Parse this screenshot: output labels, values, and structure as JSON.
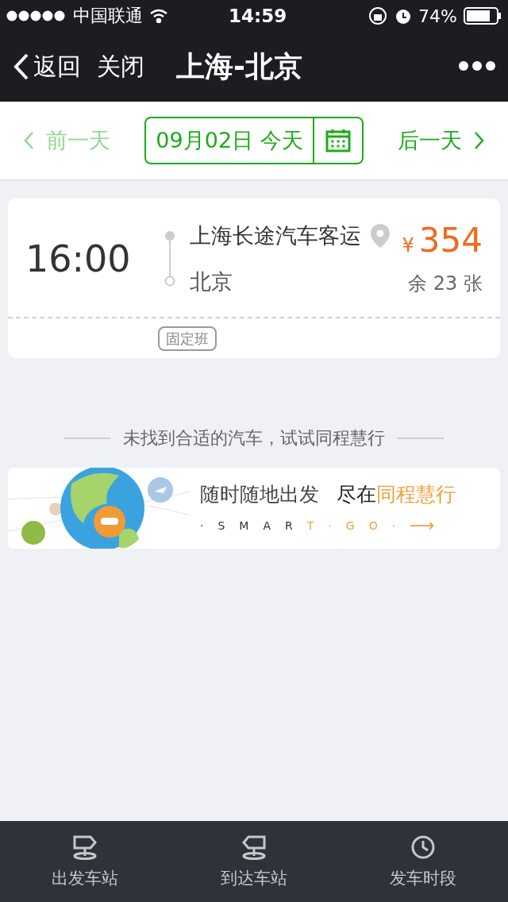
{
  "status_bar": {
    "carrier": "中国联通",
    "time": "14:59",
    "battery": "74%"
  },
  "nav_bar": {
    "back": "返回",
    "close": "关闭",
    "title": "上海-北京"
  },
  "date_bar": {
    "prev": {
      "label": "前一天",
      "disabled": true
    },
    "date": "09月02日",
    "day": "今天",
    "next": {
      "label": "后一天",
      "disabled": false
    }
  },
  "trips": [
    {
      "time": "16:00",
      "from": "上海长途汽车客运",
      "to": "北京",
      "currency": "¥",
      "price": "354",
      "remaining": "余 23 张",
      "tag": "固定班"
    }
  ],
  "suggestion": "未找到合适的汽车，试试同程慧行",
  "banner": {
    "slogan_plain": "随时随地出发",
    "slogan_dark": "尽在",
    "slogan_brand": "同程慧行",
    "letters_dark": [
      "·",
      "S",
      "M",
      "A",
      "R"
    ],
    "letters_brand": [
      "T",
      "·",
      "G",
      "O",
      "·"
    ],
    "arrow": "⟶"
  },
  "tab_bar": [
    {
      "label": "出发车站",
      "kind": "sign"
    },
    {
      "label": "到达车站",
      "kind": "sign-left"
    },
    {
      "label": "发车时段",
      "kind": "clock"
    }
  ]
}
